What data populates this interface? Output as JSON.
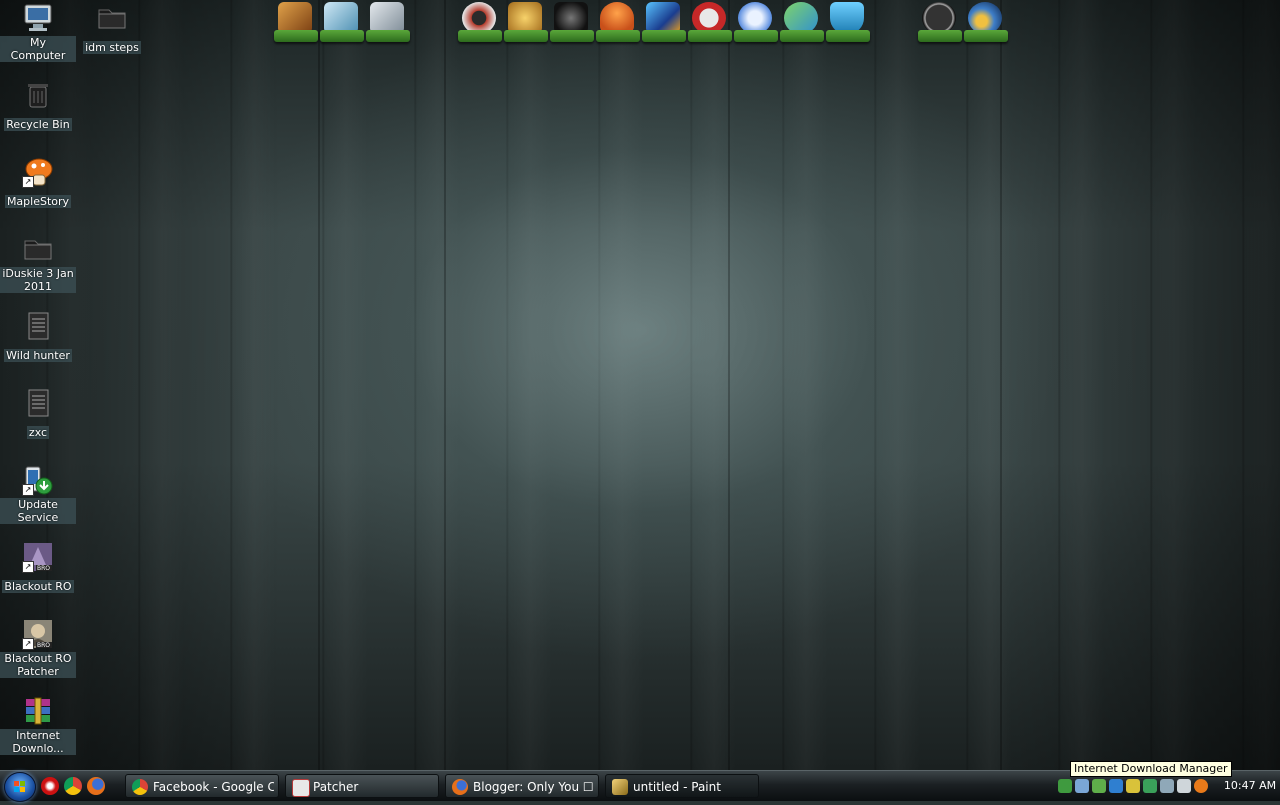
{
  "desktop": {
    "icons": [
      {
        "label": "My Computer",
        "icon": "computer-icon"
      },
      {
        "label": "idm steps",
        "icon": "folder-icon"
      },
      {
        "label": "Recycle Bin",
        "icon": "recycle-bin-icon"
      },
      {
        "label": "MapleStory",
        "icon": "mushroom-icon"
      },
      {
        "label": "iDuskie 3 Jan 2011",
        "icon": "folder-icon"
      },
      {
        "label": "Wild hunter",
        "icon": "text-file-icon"
      },
      {
        "label": "zxc",
        "icon": "text-file-icon"
      },
      {
        "label": "Update Service",
        "icon": "update-service-icon"
      },
      {
        "label": "Blackout RO",
        "icon": "game-icon"
      },
      {
        "label": "Blackout RO Patcher",
        "icon": "game-patcher-icon"
      },
      {
        "label": "Internet Downlo...",
        "icon": "winrar-archive-icon"
      }
    ]
  },
  "dock": {
    "items": [
      {
        "name": "dock-paint-icon",
        "color": "#c8702a"
      },
      {
        "name": "dock-device-icon",
        "color": "#7fb7d6"
      },
      {
        "name": "dock-documents-icon",
        "color": "#a9b6c0"
      },
      {
        "name": "dock-photoscape-icon",
        "color": "#b53b2c"
      },
      {
        "name": "dock-lightning-icon",
        "color": "#d8a23a"
      },
      {
        "name": "dock-skull-icon",
        "color": "#222222"
      },
      {
        "name": "dock-mushroom-icon",
        "color": "#e8782a"
      },
      {
        "name": "dock-dancer-icon",
        "color": "#3a7ad8"
      },
      {
        "name": "dock-no-entry-icon",
        "color": "#c62828"
      },
      {
        "name": "dock-media-player-icon",
        "color": "#5d8fe0"
      },
      {
        "name": "dock-messenger-icon",
        "color": "#4caf50"
      },
      {
        "name": "dock-shield-icon",
        "color": "#29a3d6"
      },
      {
        "name": "dock-clock-icon",
        "color": "#111111"
      },
      {
        "name": "dock-settings-icon",
        "color": "#3f7fc9"
      }
    ]
  },
  "taskbar": {
    "start_label": "",
    "quick_launch": [
      {
        "name": "opera-icon",
        "color": "#cc1111"
      },
      {
        "name": "chrome-icon",
        "color": "#e5b61a"
      },
      {
        "name": "firefox-icon",
        "color": "#e66f1a"
      }
    ],
    "tasks": [
      {
        "label": "Facebook - Google C...",
        "icon": "chrome-icon",
        "color": "#e5b61a"
      },
      {
        "label": "Patcher",
        "icon": "patcher-icon",
        "color": "#b73a3a"
      },
      {
        "label": "Blogger: Only You ☐ ...",
        "icon": "firefox-icon",
        "color": "#e66f1a"
      },
      {
        "label": "untitled - Paint",
        "icon": "paint-icon",
        "color": "#d4b058"
      }
    ],
    "tray_icons": [
      "network-icon",
      "monitor-icon",
      "update-icon",
      "security-icon",
      "volume-icon",
      "idm-icon",
      "battery-icon",
      "usb-icon",
      "avast-icon"
    ],
    "clock": "10:47 AM"
  },
  "tooltip": {
    "text": "Internet Download Manager"
  },
  "colors": {
    "label_bg": "#3c5055",
    "taskbar": "#1b2023",
    "tooltip_bg": "#ffffe1"
  }
}
